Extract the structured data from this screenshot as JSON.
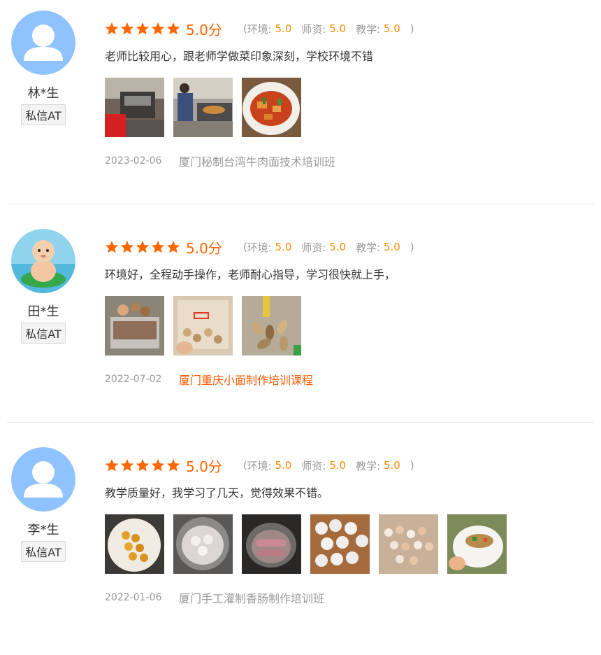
{
  "reviews": [
    {
      "user": "林*生",
      "message_button": "私信AT",
      "avatar": "default-user-icon",
      "stars": 5,
      "score": "5.0分",
      "sub_ratings": {
        "open": "(",
        "env_label": "环境:",
        "env_value": "5.0",
        "teacher_label": "师资:",
        "teacher_value": "5.0",
        "teaching_label": "教学:",
        "teaching_value": "5.0",
        "close": ")"
      },
      "comment": "老师比较用心，跟老师学做菜印象深刻，学校环境不错",
      "photos": [
        "kitchen-equipment-photo",
        "chef-cooking-photo",
        "braised-dish-photo"
      ],
      "date": "2023-02-06",
      "course": "厦门秘制台湾牛肉面技术培训班"
    },
    {
      "user": "田*生",
      "message_button": "私信AT",
      "avatar": "baby-photo-avatar",
      "stars": 5,
      "score": "5.0分",
      "sub_ratings": {
        "open": "(",
        "env_label": "环境:",
        "env_value": "5.0",
        "teacher_label": "师资:",
        "teacher_value": "5.0",
        "teaching_label": "教学:",
        "teaching_value": "5.0",
        "close": ")"
      },
      "comment": "环境好，全程动手操作，老师耐心指导，学习很快就上手，",
      "photos": [
        "nuts-container-photo",
        "nuts-bag-photo",
        "seeds-spoon-photo"
      ],
      "date": "2022-07-02",
      "course": "厦门重庆小面制作培训课程"
    },
    {
      "user": "李*生",
      "message_button": "私信AT",
      "avatar": "default-user-icon",
      "stars": 5,
      "score": "5.0分",
      "sub_ratings": {
        "open": "(",
        "env_label": "环境:",
        "env_value": "5.0",
        "teacher_label": "师资:",
        "teacher_value": "5.0",
        "teaching_label": "教学:",
        "teaching_value": "5.0",
        "close": ")"
      },
      "comment": "教学质量好，我学习了几天，觉得效果不错。",
      "photos": [
        "fried-balls-photo",
        "white-dumplings-bowl-photo",
        "sausages-pot-photo",
        "white-balls-tray-photo",
        "mixed-balls-photo",
        "stuffed-bun-photo"
      ],
      "date": "2022-01-06",
      "course": "厦门手工灌制香肠制作培训班"
    }
  ],
  "colors": {
    "accent": "#ff6600",
    "sub_value": "#ff8a00",
    "link_active": "#ff5a00",
    "avatar_bg": "#8ec3ff"
  }
}
